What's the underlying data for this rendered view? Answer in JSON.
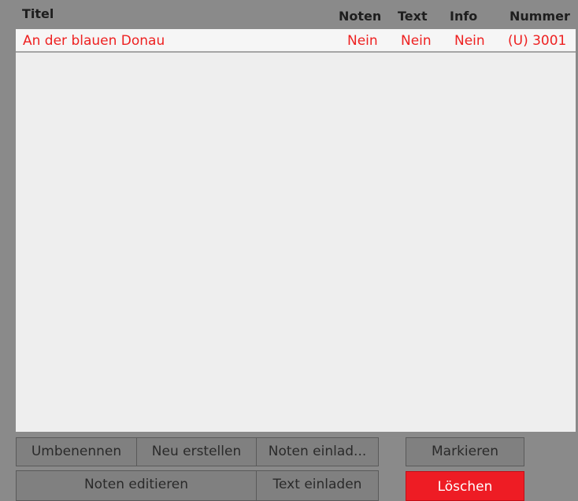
{
  "columns": {
    "title": "Titel",
    "noten": "Noten",
    "text": "Text",
    "info": "Info",
    "nummer": "Nummer"
  },
  "rows": [
    {
      "title": "An der blauen Donau",
      "noten": "Nein",
      "text": "Nein",
      "info": "Nein",
      "nummer": "(U) 3001"
    }
  ],
  "buttons": {
    "rename": "Umbenennen",
    "create": "Neu erstellen",
    "load_notes": "Noten einlad...",
    "mark": "Markieren",
    "edit_notes": "Noten editieren",
    "load_text": "Text einladen",
    "delete": "Löschen"
  },
  "colors": {
    "accent": "#ee2121",
    "delete_button": "#ee1c24",
    "panel": "#8a8a8a",
    "list_bg": "#eeeeee"
  }
}
